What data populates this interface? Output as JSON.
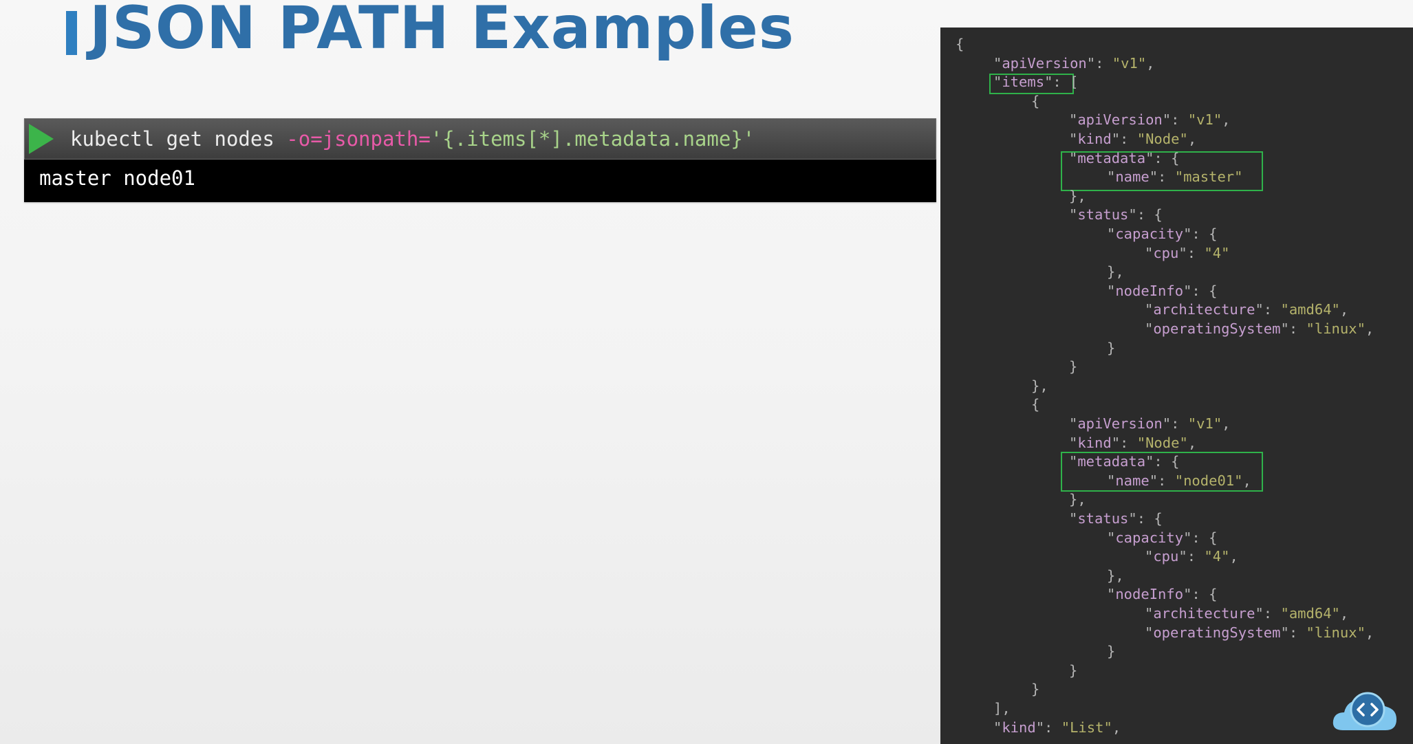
{
  "slide": {
    "title": "JSON PATH Examples"
  },
  "terminal": {
    "command_base": "kubectl get nodes ",
    "command_flag": "-o=jsonpath=",
    "command_arg": "'{.items[*].metadata.name}'",
    "output": "master node01"
  },
  "json_panel": {
    "lines": [
      {
        "indent": 0,
        "text": "{"
      },
      {
        "indent": 1,
        "key": "apiVersion",
        "value": "v1",
        "trail": ","
      },
      {
        "indent": 1,
        "key": "items",
        "trail": " ["
      },
      {
        "indent": 2,
        "text": "{"
      },
      {
        "indent": 3,
        "key": "apiVersion",
        "value": "v1",
        "trail": ","
      },
      {
        "indent": 3,
        "key": "kind",
        "value": "Node",
        "trail": ","
      },
      {
        "indent": 3,
        "key": "metadata",
        "trail": " {"
      },
      {
        "indent": 4,
        "key": "name",
        "value": "master"
      },
      {
        "indent": 3,
        "text": "},"
      },
      {
        "indent": 3,
        "key": "status",
        "trail": " {"
      },
      {
        "indent": 4,
        "key": "capacity",
        "trail": " {"
      },
      {
        "indent": 5,
        "key": "cpu",
        "value": "4"
      },
      {
        "indent": 4,
        "text": "},"
      },
      {
        "indent": 4,
        "key": "nodeInfo",
        "trail": " {"
      },
      {
        "indent": 5,
        "key": "architecture",
        "value": "amd64",
        "trail": ","
      },
      {
        "indent": 5,
        "key": "operatingSystem",
        "value": "linux",
        "trail": ","
      },
      {
        "indent": 4,
        "text": "}"
      },
      {
        "indent": 3,
        "text": "}"
      },
      {
        "indent": 2,
        "text": "},"
      },
      {
        "indent": 2,
        "text": "{"
      },
      {
        "indent": 3,
        "key": "apiVersion",
        "value": "v1",
        "trail": ","
      },
      {
        "indent": 3,
        "key": "kind",
        "value": "Node",
        "trail": ","
      },
      {
        "indent": 3,
        "key": "metadata",
        "trail": " {"
      },
      {
        "indent": 4,
        "key": "name",
        "value": "node01",
        "trail": ","
      },
      {
        "indent": 3,
        "text": "},"
      },
      {
        "indent": 3,
        "key": "status",
        "trail": " {"
      },
      {
        "indent": 4,
        "key": "capacity",
        "trail": " {"
      },
      {
        "indent": 5,
        "key": "cpu",
        "value": "4",
        "trail": ","
      },
      {
        "indent": 4,
        "text": "},"
      },
      {
        "indent": 4,
        "key": "nodeInfo",
        "trail": " {"
      },
      {
        "indent": 5,
        "key": "architecture",
        "value": "amd64",
        "trail": ","
      },
      {
        "indent": 5,
        "key": "operatingSystem",
        "value": "linux",
        "trail": ","
      },
      {
        "indent": 4,
        "text": "}"
      },
      {
        "indent": 3,
        "text": "}"
      },
      {
        "indent": 2,
        "text": "}"
      },
      {
        "indent": 1,
        "text": "],"
      },
      {
        "indent": 1,
        "key": "kind",
        "value": "List",
        "trail": ","
      }
    ]
  },
  "highlights": [
    {
      "target": "items-key"
    },
    {
      "target": "master-metadata"
    },
    {
      "target": "node01-metadata"
    }
  ],
  "logo": {
    "icon": "code-cloud-icon"
  },
  "colors": {
    "title": "#2f6fa8",
    "accent_bar": "#2f7fc0",
    "play": "#3cb44a",
    "flag": "#e85aa8",
    "arg": "#a8d38a",
    "json_key": "#c79fd0",
    "json_string": "#b5b36b",
    "highlight": "#2fb24a",
    "panel_bg": "#2b2b2b"
  }
}
